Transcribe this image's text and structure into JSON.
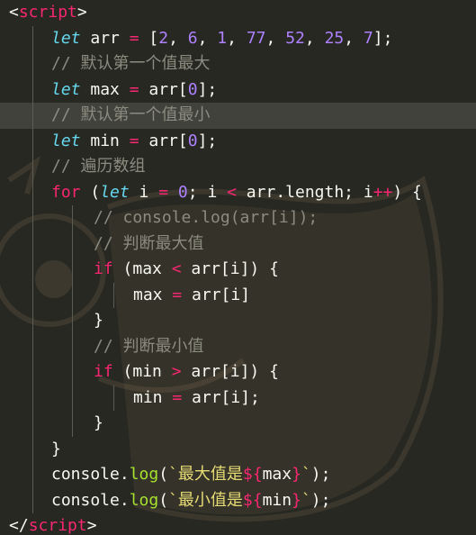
{
  "editor": {
    "colors": {
      "background": "#272822",
      "highlight_line": "#3a3b33",
      "keyword": "#66d9ef",
      "control": "#f92672",
      "number": "#ae81ff",
      "comment": "#8c8b80",
      "function": "#a6e22e",
      "string": "#e6db74",
      "text": "#f8f8f2"
    },
    "highlighted_line": 4,
    "lines": [
      [
        [
          "tag-bracket",
          "<"
        ],
        [
          "tag-name",
          "script"
        ],
        [
          "tag-bracket",
          ">"
        ]
      ],
      [
        [
          "kw",
          "let"
        ],
        [
          "plain",
          " arr "
        ],
        [
          "op",
          "="
        ],
        [
          "plain",
          " ["
        ],
        [
          "num",
          "2"
        ],
        [
          "plain",
          ", "
        ],
        [
          "num",
          "6"
        ],
        [
          "plain",
          ", "
        ],
        [
          "num",
          "1"
        ],
        [
          "plain",
          ", "
        ],
        [
          "num",
          "77"
        ],
        [
          "plain",
          ", "
        ],
        [
          "num",
          "52"
        ],
        [
          "plain",
          ", "
        ],
        [
          "num",
          "25"
        ],
        [
          "plain",
          ", "
        ],
        [
          "num",
          "7"
        ],
        [
          "plain",
          "];"
        ]
      ],
      [
        [
          "cm",
          "// 默认第一个值最大"
        ]
      ],
      [
        [
          "kw",
          "let"
        ],
        [
          "plain",
          " max "
        ],
        [
          "op",
          "="
        ],
        [
          "plain",
          " arr["
        ],
        [
          "num",
          "0"
        ],
        [
          "plain",
          "];"
        ]
      ],
      [
        [
          "cm",
          "// 默认第一个值最小"
        ]
      ],
      [
        [
          "kw",
          "let"
        ],
        [
          "plain",
          " min "
        ],
        [
          "op",
          "="
        ],
        [
          "plain",
          " arr["
        ],
        [
          "num",
          "0"
        ],
        [
          "plain",
          "];"
        ]
      ],
      [
        [
          "cm",
          "// 遍历数组"
        ]
      ],
      [
        [
          "kw2",
          "for"
        ],
        [
          "plain",
          " ("
        ],
        [
          "kw",
          "let"
        ],
        [
          "plain",
          " i "
        ],
        [
          "op",
          "="
        ],
        [
          "plain",
          " "
        ],
        [
          "num",
          "0"
        ],
        [
          "plain",
          "; i "
        ],
        [
          "op",
          "<"
        ],
        [
          "plain",
          " arr.length; i"
        ],
        [
          "op",
          "++"
        ],
        [
          "plain",
          ") {"
        ]
      ],
      [
        [
          "cm",
          "// console.log(arr[i]);"
        ]
      ],
      [
        [
          "cm",
          "// 判断最大值"
        ]
      ],
      [
        [
          "kw2",
          "if"
        ],
        [
          "plain",
          " (max "
        ],
        [
          "op",
          "<"
        ],
        [
          "plain",
          " arr[i]) {"
        ]
      ],
      [
        [
          "plain",
          "max "
        ],
        [
          "op",
          "="
        ],
        [
          "plain",
          " arr[i]"
        ]
      ],
      [
        [
          "plain",
          "}"
        ]
      ],
      [
        [
          "cm",
          "// 判断最小值"
        ]
      ],
      [
        [
          "kw2",
          "if"
        ],
        [
          "plain",
          " (min "
        ],
        [
          "op",
          ">"
        ],
        [
          "plain",
          " arr[i]) {"
        ]
      ],
      [
        [
          "plain",
          "min "
        ],
        [
          "op",
          "="
        ],
        [
          "plain",
          " arr[i];"
        ]
      ],
      [
        [
          "plain",
          "}"
        ]
      ],
      [
        [
          "plain",
          "}"
        ]
      ],
      [
        [
          "plain",
          "console."
        ],
        [
          "fn",
          "log"
        ],
        [
          "plain",
          "("
        ],
        [
          "str",
          "`最大值是"
        ],
        [
          "tpl",
          "${"
        ],
        [
          "plain",
          "max"
        ],
        [
          "tpl",
          "}"
        ],
        [
          "str",
          "`"
        ],
        [
          "plain",
          ");"
        ]
      ],
      [
        [
          "plain",
          "console."
        ],
        [
          "fn",
          "log"
        ],
        [
          "plain",
          "("
        ],
        [
          "str",
          "`最小值是"
        ],
        [
          "tpl",
          "${"
        ],
        [
          "plain",
          "min"
        ],
        [
          "tpl",
          "}"
        ],
        [
          "str",
          "`"
        ],
        [
          "plain",
          ");"
        ]
      ],
      [
        [
          "tag-bracket",
          "</"
        ],
        [
          "tag-name",
          "script"
        ],
        [
          "tag-bracket",
          ">"
        ]
      ]
    ]
  }
}
